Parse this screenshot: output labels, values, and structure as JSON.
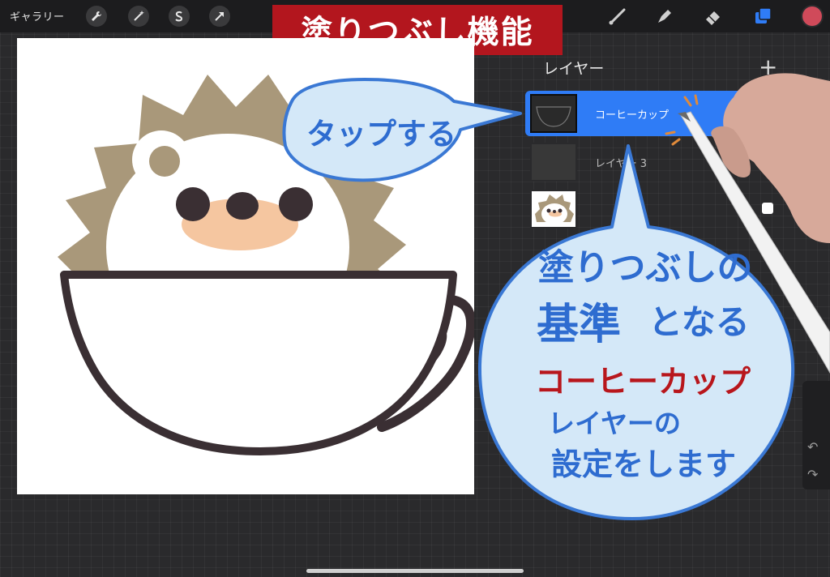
{
  "toolbar": {
    "gallery_label": "ギャラリー",
    "icons": [
      "wrench-icon",
      "magic-wand-icon",
      "selection-s-icon",
      "transform-arrow-icon",
      "brush-icon",
      "smudge-icon",
      "eraser-icon",
      "layers-icon",
      "color-icon"
    ],
    "color_swatch": "#d04a5a"
  },
  "title_banner": "塗りつぶし機能",
  "layers_panel": {
    "title": "レイヤー",
    "add_label": "+",
    "layers": [
      {
        "name": "コーヒーカップ",
        "selected": true
      },
      {
        "name": "レイヤー 3",
        "selected": false
      },
      {
        "name": "",
        "selected": false
      }
    ]
  },
  "callouts": {
    "tap": "タップする",
    "explanation_line1": "塗りつぶしの",
    "explanation_line2a": "基準",
    "explanation_line2b": "となる",
    "explanation_line3": "コーヒーカップ",
    "explanation_line4": "レイヤーの",
    "explanation_line5": "設定をします"
  },
  "sidebar": {
    "undo": "↶",
    "redo": "↷"
  },
  "colors": {
    "accent_blue": "#2f7cf6",
    "banner_red": "#b3161e",
    "bubble_fill": "#d4e8f8",
    "bubble_stroke": "#3a78d4",
    "handwriting_blue": "#2e6cd0",
    "handwriting_red": "#b8161c"
  }
}
